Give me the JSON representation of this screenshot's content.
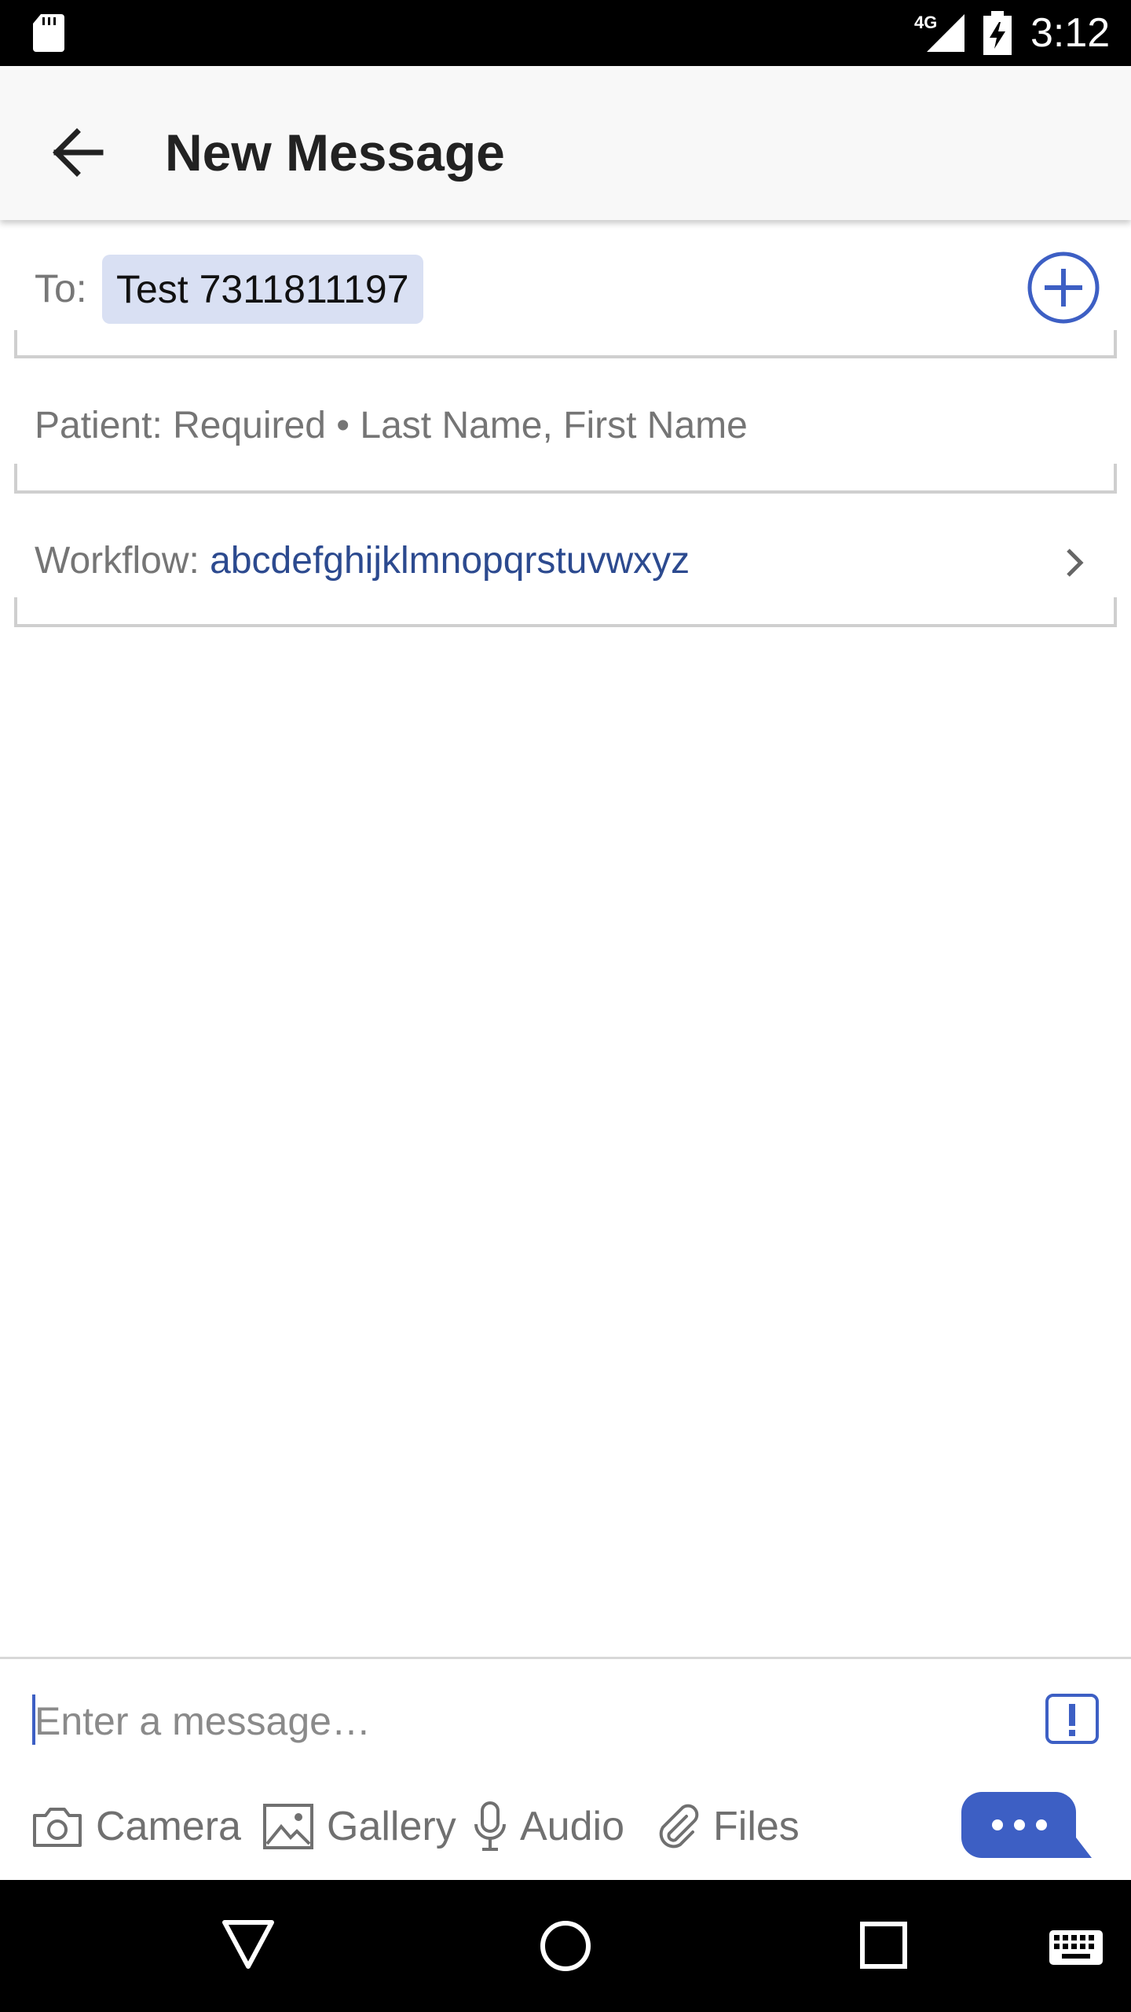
{
  "status_bar": {
    "network": "4G",
    "time": "3:12"
  },
  "app_bar": {
    "title": "New Message",
    "back_icon": "arrow-left-icon"
  },
  "to_field": {
    "label": "To:",
    "recipient": "Test 7311811197",
    "add_icon": "plus-circle-icon"
  },
  "patient_field": {
    "text": "Patient: Required • Last Name, First Name"
  },
  "workflow_field": {
    "label": "Workflow:",
    "value": "abcdefghijklmnopqrstuvwxyz",
    "chevron_icon": "chevron-right-icon"
  },
  "compose": {
    "placeholder": "Enter a message…",
    "priority_icon": "exclamation-icon",
    "attachments": [
      {
        "label": "Camera",
        "icon": "camera-icon"
      },
      {
        "label": "Gallery",
        "icon": "image-icon"
      },
      {
        "label": "Audio",
        "icon": "microphone-icon"
      },
      {
        "label": "Files",
        "icon": "paperclip-icon"
      }
    ],
    "send_icon": "chat-bubble-dots-icon"
  },
  "colors": {
    "accent": "#3d5fc4",
    "chip_bg": "#d9e0f3",
    "workflow_value": "#2c4a8f"
  }
}
